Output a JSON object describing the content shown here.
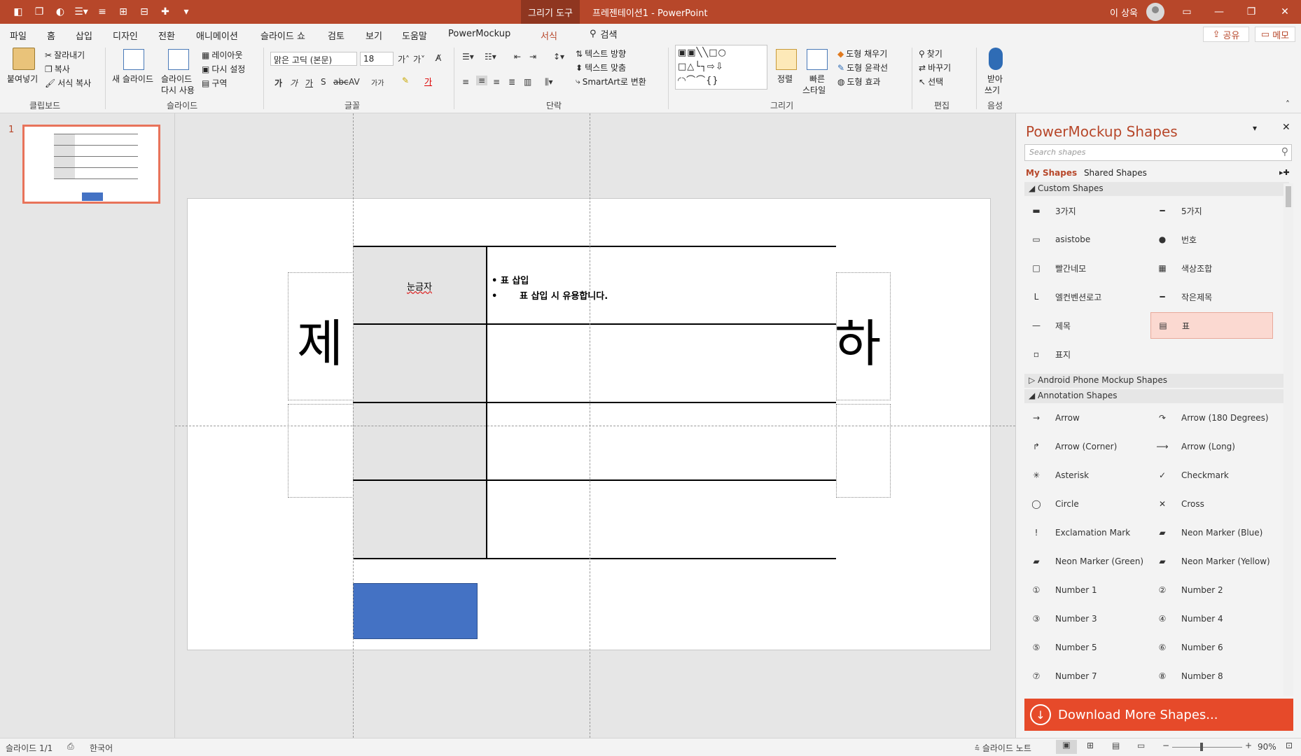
{
  "titlebar": {
    "contextual_tab": "그리기 도구",
    "document_title": "프레젠테이션1  -  PowerPoint",
    "user_name": "이 상욱"
  },
  "tabs": [
    "파일",
    "홈",
    "삽입",
    "디자인",
    "전환",
    "애니메이션",
    "슬라이드 쇼",
    "검토",
    "보기",
    "도움말",
    "PowerMockup",
    "서식"
  ],
  "search_label": "검색",
  "share_label": "공유",
  "memo_label": "메모",
  "ribbon": {
    "clipboard": {
      "paste": "붙여넣기",
      "cut": "잘라내기",
      "copy": "복사",
      "format_painter": "서식 복사",
      "label": "클립보드"
    },
    "slides": {
      "new_slide": "새 슬라이드",
      "reuse_slides_1": "슬라이드",
      "reuse_slides_2": "다시 사용",
      "layout": "레이아웃",
      "reset": "다시 설정",
      "section": "구역",
      "label": "슬라이드"
    },
    "font": {
      "font_name": "맑은 고딕 (본문)",
      "font_size": "18",
      "label": "글꼴"
    },
    "paragraph": {
      "text_direction": "텍스트 방향",
      "align_text": "텍스트 맞춤",
      "smartart": "SmartArt로 변환",
      "label": "단락"
    },
    "drawing": {
      "arrange": "정렬",
      "quick_styles_1": "빠른",
      "quick_styles_2": "스타일",
      "shape_fill": "도형 채우기",
      "shape_outline": "도형 윤곽선",
      "shape_effects": "도형 효과",
      "label": "그리기"
    },
    "editing": {
      "find": "찾기",
      "replace": "바꾸기",
      "select": "선택",
      "label": "편집"
    },
    "voice": {
      "dictate_1": "받아",
      "dictate_2": "쓰기",
      "label": "음성"
    }
  },
  "slide_number": "1",
  "slide": {
    "title_left_char": "제",
    "title_right_char": "하",
    "table_header": "눈금자",
    "bullet1": "• 표 삽입",
    "bullet2": "•       표 삽입 시 유용합니다."
  },
  "pane": {
    "title": "PowerMockup Shapes",
    "search_placeholder": "Search shapes",
    "tab_my": "My Shapes",
    "tab_shared": "Shared Shapes",
    "section_custom": "Custom Shapes",
    "section_android": "Android Phone Mockup Shapes",
    "section_annotation": "Annotation Shapes",
    "custom_shapes": [
      "3가지",
      "5가지",
      "asistobe",
      "번호",
      "빨간네모",
      "색상조합",
      "엘컨벤션로고",
      "작은제목",
      "제목",
      "표",
      "표지"
    ],
    "annotation_shapes": [
      "Arrow",
      "Arrow (180 Degrees)",
      "Arrow (Corner)",
      "Arrow (Long)",
      "Asterisk",
      "Checkmark",
      "Circle",
      "Cross",
      "Exclamation Mark",
      "Neon Marker (Blue)",
      "Neon Marker (Green)",
      "Neon Marker (Yellow)",
      "Number 1",
      "Number 2",
      "Number 3",
      "Number 4",
      "Number 5",
      "Number 6",
      "Number 7",
      "Number 8"
    ],
    "download_label": "Download More Shapes..."
  },
  "status": {
    "slide_info": "슬라이드 1/1",
    "language": "한국어",
    "notes": "슬라이드 노트",
    "zoom": "90%"
  }
}
